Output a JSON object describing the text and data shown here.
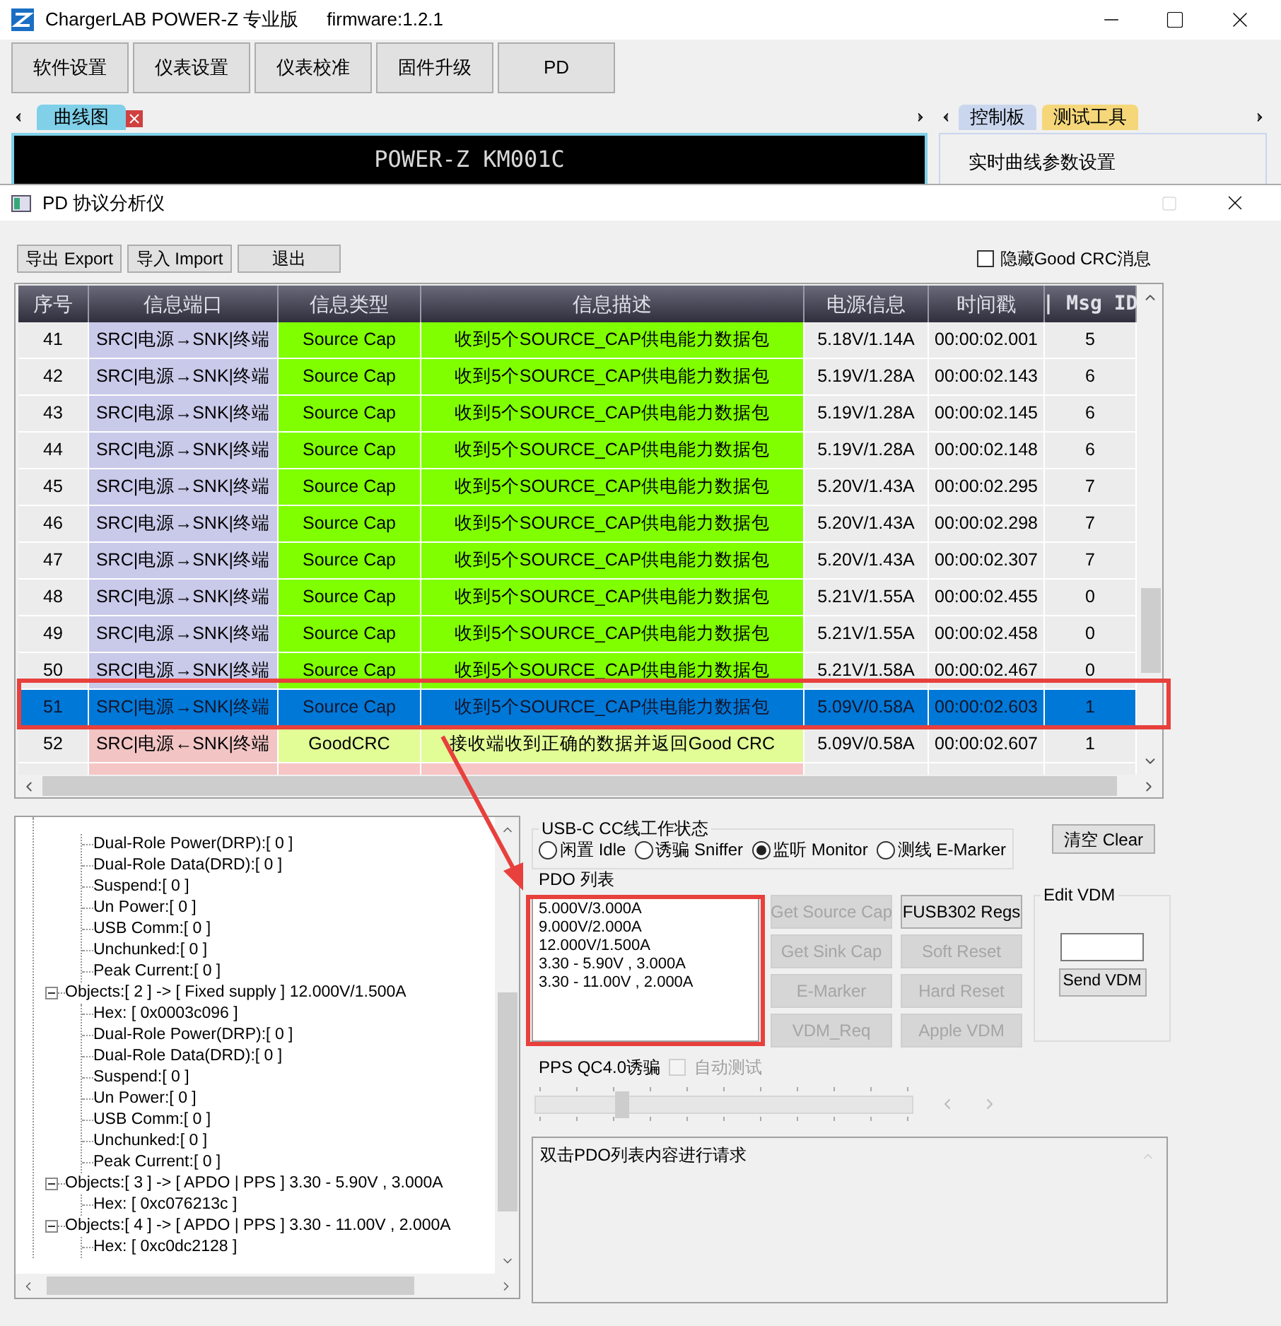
{
  "app_window": {
    "title": "ChargerLAB POWER-Z 专业版",
    "firmware": "firmware:1.2.1",
    "toolbar": [
      "软件设置",
      "仪表设置",
      "仪表校准",
      "固件升级",
      "PD"
    ],
    "left_tabs": [
      {
        "label": "曲线图",
        "selected": true
      }
    ],
    "chart_title": "POWER-Z KM001C",
    "right_tabs": [
      {
        "label": "控制板",
        "selected": false
      },
      {
        "label": "测试工具",
        "selected": true
      }
    ],
    "right_group": "实时曲线参数设置"
  },
  "dialog": {
    "title": "PD 协议分析仪",
    "buttons": [
      "导出 Export",
      "导入 Import",
      "退出"
    ],
    "hide_crc": {
      "label": "隐藏Good CRC消息",
      "checked": false
    },
    "table": {
      "columns": [
        "序号",
        "信息端口",
        "信息类型",
        "信息描述",
        "电源信息",
        "时间戳",
        "| Msg ID"
      ],
      "rows": [
        {
          "kind": "source_cap",
          "selected": false,
          "cells": [
            "41",
            "SRC|电源→SNK|终端",
            "Source Cap",
            "收到5个SOURCE_CAP供电能力数据包",
            "5.18V/1.14A",
            "00:00:02.001",
            "5"
          ]
        },
        {
          "kind": "source_cap",
          "selected": false,
          "cells": [
            "42",
            "SRC|电源→SNK|终端",
            "Source Cap",
            "收到5个SOURCE_CAP供电能力数据包",
            "5.19V/1.28A",
            "00:00:02.143",
            "6"
          ]
        },
        {
          "kind": "source_cap",
          "selected": false,
          "cells": [
            "43",
            "SRC|电源→SNK|终端",
            "Source Cap",
            "收到5个SOURCE_CAP供电能力数据包",
            "5.19V/1.28A",
            "00:00:02.145",
            "6"
          ]
        },
        {
          "kind": "source_cap",
          "selected": false,
          "cells": [
            "44",
            "SRC|电源→SNK|终端",
            "Source Cap",
            "收到5个SOURCE_CAP供电能力数据包",
            "5.19V/1.28A",
            "00:00:02.148",
            "6"
          ]
        },
        {
          "kind": "source_cap",
          "selected": false,
          "cells": [
            "45",
            "SRC|电源→SNK|终端",
            "Source Cap",
            "收到5个SOURCE_CAP供电能力数据包",
            "5.20V/1.43A",
            "00:00:02.295",
            "7"
          ]
        },
        {
          "kind": "source_cap",
          "selected": false,
          "cells": [
            "46",
            "SRC|电源→SNK|终端",
            "Source Cap",
            "收到5个SOURCE_CAP供电能力数据包",
            "5.20V/1.43A",
            "00:00:02.298",
            "7"
          ]
        },
        {
          "kind": "source_cap",
          "selected": false,
          "cells": [
            "47",
            "SRC|电源→SNK|终端",
            "Source Cap",
            "收到5个SOURCE_CAP供电能力数据包",
            "5.20V/1.43A",
            "00:00:02.307",
            "7"
          ]
        },
        {
          "kind": "source_cap",
          "selected": false,
          "cells": [
            "48",
            "SRC|电源→SNK|终端",
            "Source Cap",
            "收到5个SOURCE_CAP供电能力数据包",
            "5.21V/1.55A",
            "00:00:02.455",
            "0"
          ]
        },
        {
          "kind": "source_cap",
          "selected": false,
          "cells": [
            "49",
            "SRC|电源→SNK|终端",
            "Source Cap",
            "收到5个SOURCE_CAP供电能力数据包",
            "5.21V/1.55A",
            "00:00:02.458",
            "0"
          ]
        },
        {
          "kind": "source_cap",
          "selected": false,
          "cells": [
            "50",
            "SRC|电源→SNK|终端",
            "Source Cap",
            "收到5个SOURCE_CAP供电能力数据包",
            "5.21V/1.58A",
            "00:00:02.467",
            "0"
          ]
        },
        {
          "kind": "source_cap",
          "selected": true,
          "cells": [
            "51",
            "SRC|电源→SNK|终端",
            "Source Cap",
            "收到5个SOURCE_CAP供电能力数据包",
            "5.09V/0.58A",
            "00:00:02.603",
            "1"
          ]
        },
        {
          "kind": "good_crc",
          "selected": false,
          "cells": [
            "52",
            "SRC|电源←SNK|终端",
            "GoodCRC",
            "接收端收到正确的数据并返回Good CRC",
            "5.09V/0.58A",
            "00:00:02.607",
            "1"
          ]
        },
        {
          "kind": "request",
          "selected": false
        }
      ]
    },
    "tree": [
      {
        "children": [
          {
            "label": "Dual-Role Power(DRP):[ 0 ]"
          },
          {
            "label": "Dual-Role Data(DRD):[ 0 ]"
          },
          {
            "label": "Suspend:[ 0 ]"
          },
          {
            "label": "Un Power:[ 0 ]"
          },
          {
            "label": "USB Comm:[ 0 ]"
          },
          {
            "label": "Unchunked:[ 0 ]"
          },
          {
            "label": "Peak Current:[  0 ]"
          }
        ]
      },
      {
        "label": "Objects:[ 2 ] -> [ Fixed supply ] 12.000V/1.500A",
        "expanded": true,
        "children": [
          {
            "label": "Hex: [ 0x0003c096 ]"
          },
          {
            "label": "Dual-Role Power(DRP):[ 0 ]"
          },
          {
            "label": "Dual-Role Data(DRD):[ 0 ]"
          },
          {
            "label": "Suspend:[ 0 ]"
          },
          {
            "label": "Un Power:[ 0 ]"
          },
          {
            "label": "USB Comm:[ 0 ]"
          },
          {
            "label": "Unchunked:[ 0 ]"
          },
          {
            "label": "Peak Current:[  0 ]"
          }
        ]
      },
      {
        "label": "Objects:[ 3 ] -> [ APDO | PPS ] 3.30 - 5.90V , 3.000A",
        "expanded": true,
        "children": [
          {
            "label": "Hex: [ 0xc076213c ]"
          }
        ]
      },
      {
        "label": "Objects:[ 4 ] -> [ APDO | PPS ] 3.30 - 11.00V , 2.000A",
        "expanded": true,
        "children": [
          {
            "label": "Hex: [ 0xc0dc2128 ]"
          }
        ]
      }
    ],
    "cc_state": {
      "title": "USB-C CC线工作状态",
      "options": [
        {
          "label": "闲置 Idle",
          "selected": false
        },
        {
          "label": "诱骗 Sniffer",
          "selected": false
        },
        {
          "label": "监听 Monitor",
          "selected": true
        },
        {
          "label": "测线 E-Marker",
          "selected": false
        }
      ]
    },
    "clear_button": "清空 Clear",
    "pdo": {
      "title": "PDO 列表",
      "items": [
        "5.000V/3.000A",
        "9.000V/2.000A",
        "12.000V/1.500A",
        "3.30 - 5.90V , 3.000A",
        "3.30 - 11.00V , 2.000A"
      ]
    },
    "commands": [
      {
        "label": "Get Source Cap",
        "disabled": true
      },
      {
        "label": "FUSB302 Regs",
        "disabled": false
      },
      {
        "label": "Get Sink Cap",
        "disabled": true
      },
      {
        "label": "Soft Reset",
        "disabled": true
      },
      {
        "label": "E-Marker",
        "disabled": true
      },
      {
        "label": "Hard Reset",
        "disabled": true
      },
      {
        "label": "VDM_Req",
        "disabled": true
      },
      {
        "label": "Apple VDM",
        "disabled": true
      }
    ],
    "edit_vdm": {
      "title": "Edit VDM",
      "button": "Send VDM"
    },
    "pps": {
      "label": "PPS QC4.0诱骗",
      "auto_test": {
        "label": "自动测试",
        "checked": false,
        "disabled": true
      },
      "level": 0.22
    },
    "log": "双击PDO列表内容进行请求"
  }
}
